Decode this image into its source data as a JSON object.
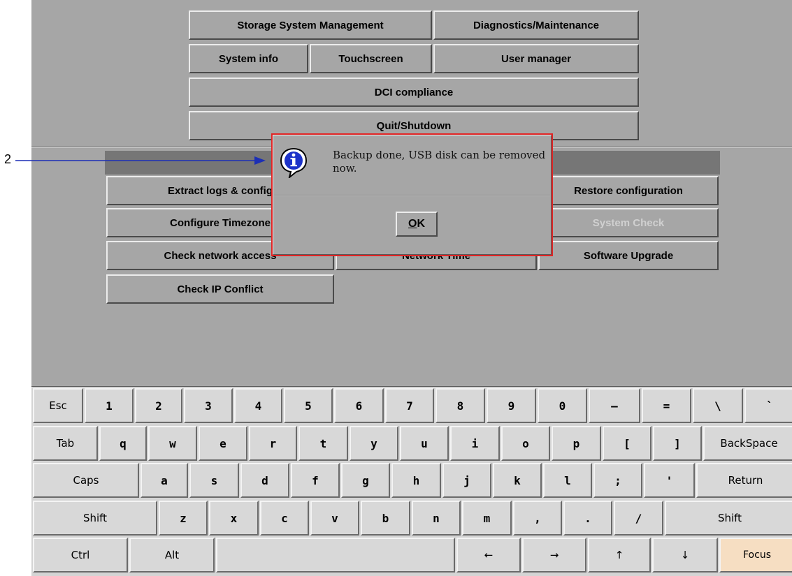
{
  "top_menu": {
    "storage": "Storage System Management",
    "diagnostics": "Diagnostics/Maintenance",
    "system_info": "System info",
    "touchscreen": "Touchscreen",
    "user_manager": "User manager",
    "dci": "DCI compliance",
    "quit": "Quit/Shutdown"
  },
  "panel": {
    "extract_logs": "Extract logs & config",
    "restore_config": "Restore configuration",
    "configure_timezone": "Configure Timezone",
    "system_check": "System Check",
    "check_network": "Check network access",
    "network_time": "Network Time",
    "software_upgrade": "Software Upgrade",
    "check_ip": "Check IP Conflict"
  },
  "dialog": {
    "icon": "info-icon",
    "message": "Backup done, USB disk can be removed now.",
    "ok_label": "OK",
    "ok_mnemonic": "O",
    "ok_rest": "K",
    "border_color": "#e02424"
  },
  "annotation": {
    "label": "2",
    "color": "#1c2fb5"
  },
  "keyboard": {
    "row1": [
      "Esc",
      "1",
      "2",
      "3",
      "4",
      "5",
      "6",
      "7",
      "8",
      "9",
      "0",
      "–",
      "=",
      "\\",
      "`"
    ],
    "row2": [
      "Tab",
      "q",
      "w",
      "e",
      "r",
      "t",
      "y",
      "u",
      "i",
      "o",
      "p",
      "[",
      "]",
      "BackSpace"
    ],
    "row3": [
      "Caps",
      "a",
      "s",
      "d",
      "f",
      "g",
      "h",
      "j",
      "k",
      "l",
      ";",
      "'",
      "Return"
    ],
    "row4": [
      "Shift",
      "z",
      "x",
      "c",
      "v",
      "b",
      "n",
      "m",
      ",",
      ".",
      "/",
      "Shift"
    ],
    "row5": [
      "Ctrl",
      "Alt",
      "",
      "←",
      "→",
      "↑",
      "↓",
      "Focus"
    ]
  }
}
